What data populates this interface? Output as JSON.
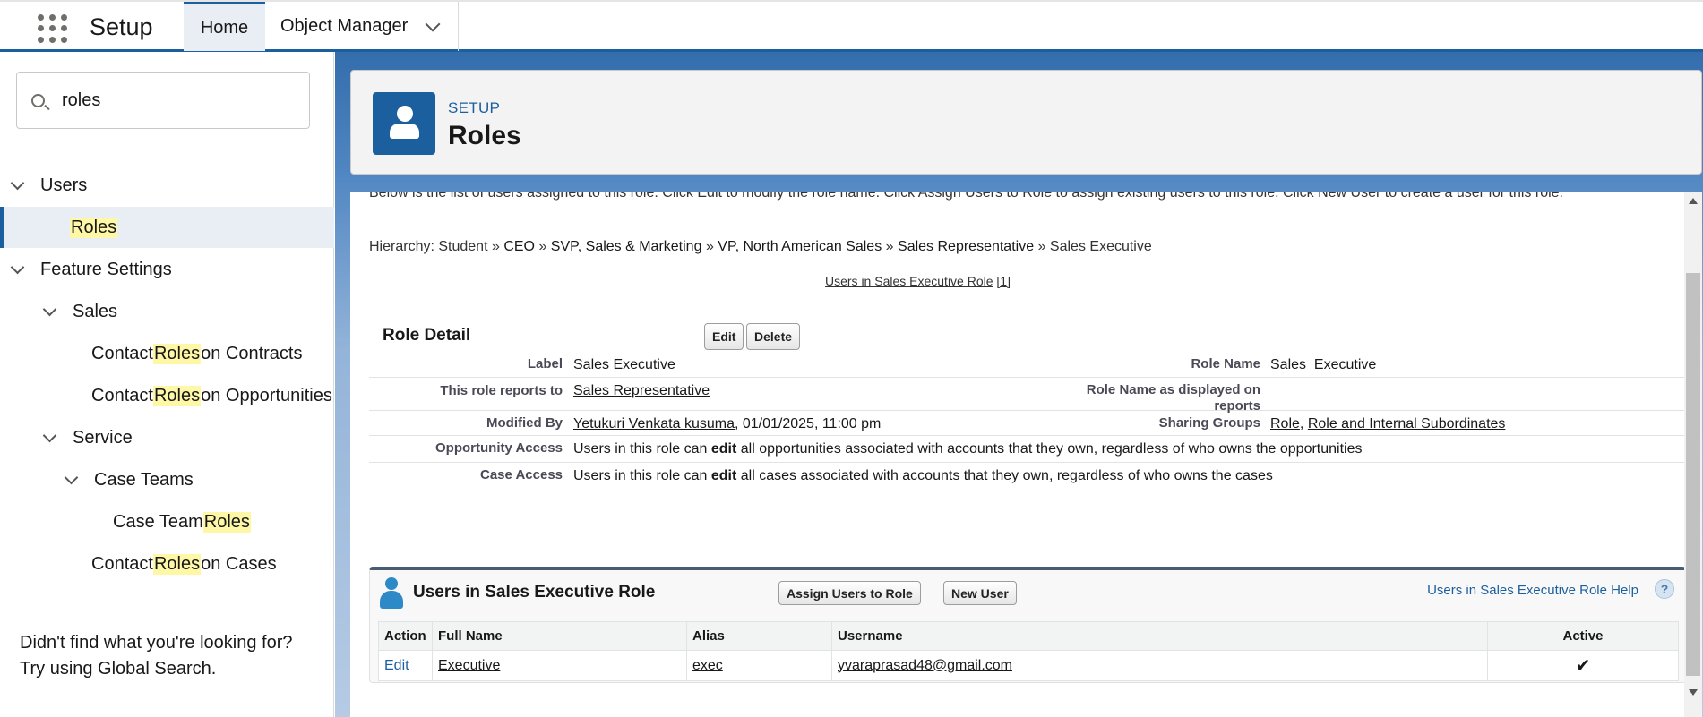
{
  "app": {
    "name": "Setup",
    "tabs": [
      {
        "label": "Home"
      },
      {
        "label": "Object Manager"
      }
    ]
  },
  "sidebar": {
    "search_value": "roles",
    "tree": [
      {
        "label": "Users"
      },
      {
        "label_prefix": "",
        "label_highlight": "Roles",
        "label_suffix": ""
      },
      {
        "label": "Feature Settings"
      },
      {
        "label": "Sales"
      },
      {
        "label_prefix": "Contact ",
        "label_highlight": "Roles",
        "label_suffix": " on Contracts"
      },
      {
        "label_prefix": "Contact ",
        "label_highlight": "Roles",
        "label_suffix": " on Opportunities"
      },
      {
        "label": "Service"
      },
      {
        "label": "Case Teams"
      },
      {
        "label_prefix": "Case Team ",
        "label_highlight": "Roles",
        "label_suffix": ""
      },
      {
        "label_prefix": "Contact ",
        "label_highlight": "Roles",
        "label_suffix": " on Cases"
      }
    ],
    "footer_line1": "Didn't find what you're looking for?",
    "footer_line2": "Try using Global Search."
  },
  "header": {
    "eyebrow": "SETUP",
    "title": "Roles"
  },
  "content": {
    "description": "Below is the list of users assigned to this role. Click Edit to modify the role name. Click Assign Users to Role to assign existing users to this role. Click New User to create a user for this role.",
    "hierarchy": {
      "prefix": "Hierarchy: Student »",
      "links": [
        "CEO",
        "SVP, Sales & Marketing",
        "VP, North American Sales",
        "Sales Representative"
      ],
      "sep": "»",
      "current": "Sales Executive"
    },
    "users_link": "Users in Sales Executive Role",
    "users_count": "[1]",
    "role_detail": {
      "title": "Role Detail",
      "edit_button": "Edit",
      "delete_button": "Delete",
      "label_label": "Label",
      "label_value": "Sales Executive",
      "role_name_label": "Role Name",
      "role_name_value": "Sales_Executive",
      "reports_to_label": "This role reports to",
      "reports_to_value": "Sales Representative",
      "displayed_label_1": "Role Name as displayed on",
      "displayed_label_2": "reports",
      "modified_by_label": "Modified By",
      "modified_by_user": "Yetukuri Venkata kusuma",
      "modified_by_date": ", 01/01/2025, 11:00 pm",
      "sharing_groups_label": "Sharing Groups",
      "sharing_group_1": "Role",
      "sharing_sep": ",",
      "sharing_group_2": "Role and Internal Subordinates",
      "opp_access_label": "Opportunity Access",
      "opp_access_pre": "Users in this role can",
      "opp_access_bold": "edit",
      "opp_access_post": "all opportunities associated with accounts that they own, regardless of who owns the opportunities",
      "case_access_label": "Case Access",
      "case_access_pre": "Users in this role can",
      "case_access_bold": "edit",
      "case_access_post": "all cases associated with accounts that they own, regardless of who owns the cases"
    },
    "users_section": {
      "title": "Users in Sales Executive Role",
      "assign_button": "Assign Users to Role",
      "new_user_button": "New User",
      "help_link": "Users in Sales Executive Role Help",
      "help_icon": "?",
      "columns": [
        "Action",
        "Full Name",
        "Alias",
        "Username",
        "Active"
      ],
      "rows": [
        {
          "action": "Edit",
          "full_name": "Executive",
          "alias": "exec",
          "username": "yvaraprasad48@gmail.com",
          "active": "✔"
        }
      ]
    }
  }
}
